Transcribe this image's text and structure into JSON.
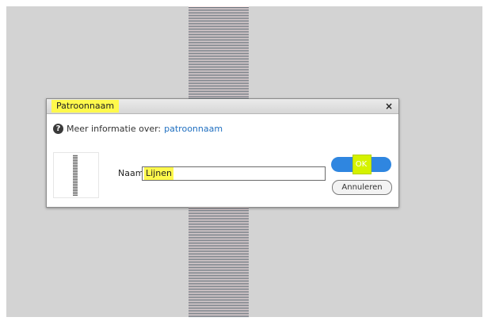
{
  "dialog": {
    "title": "Patroonnaam",
    "close_symbol": "×",
    "help_icon": "question-circle-icon",
    "help_icon_glyph": "?",
    "info_text": "Meer informatie over:",
    "info_link": "patroonnaam",
    "name_label": "Naam:",
    "name_value": "Lijnen",
    "ok_label": "OK",
    "cancel_label": "Annuleren"
  },
  "colors": {
    "highlight_yellow": "#fff94c",
    "ok_blue": "#2f86e0",
    "link_blue": "#1f6fc0",
    "background_gray": "#d3d3d3"
  }
}
